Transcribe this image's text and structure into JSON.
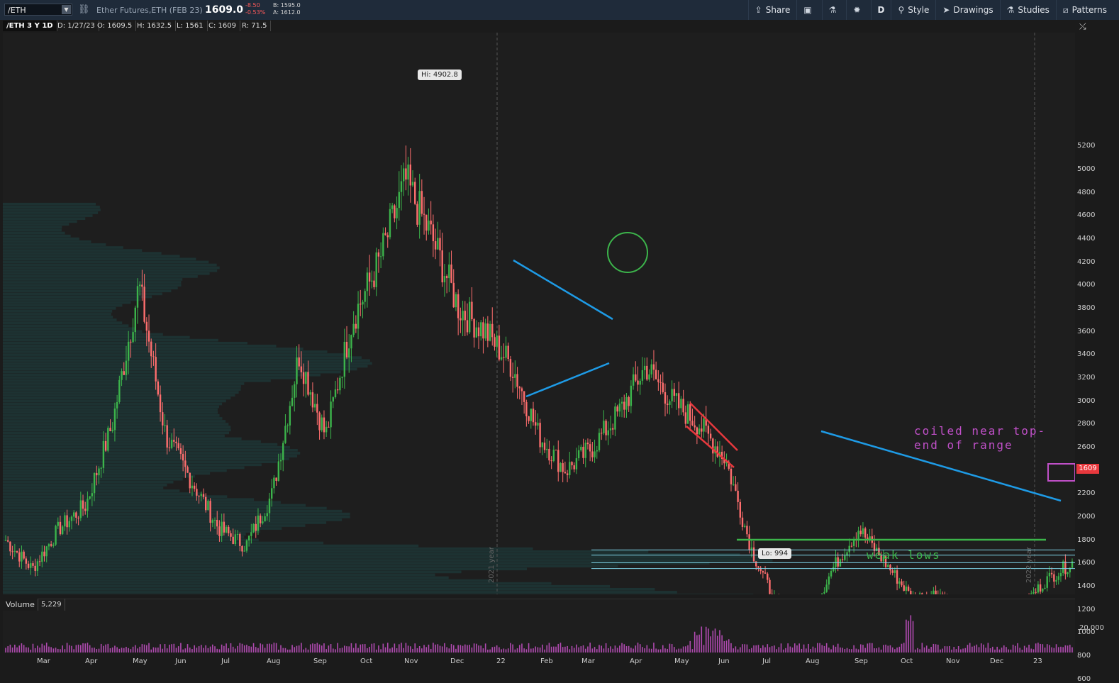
{
  "toolbar": {
    "symbol": "/ETH",
    "description": "Ether Futures,ETH (FEB 23)",
    "last_price": "1609.0",
    "net_change": "-8.50",
    "pct_change": "-0.53%",
    "bid": "B: 1595.0",
    "ask": "A: 1612.0",
    "share_label": "Share",
    "aggregation": "D",
    "style_label": "Style",
    "drawings_label": "Drawings",
    "studies_label": "Studies",
    "patterns_label": "Patterns"
  },
  "info": {
    "title": "/ETH 3 Y 1D",
    "date": "D: 1/27/23",
    "open": "O: 1609.5",
    "high": "H: 1632.5",
    "low": "L: 1561",
    "close": "C: 1609",
    "range": "R: 71.5"
  },
  "y_ticks": [
    "5200",
    "5000",
    "4800",
    "4600",
    "4400",
    "4200",
    "4000",
    "3800",
    "3600",
    "3400",
    "3200",
    "3000",
    "2800",
    "2600",
    "2400",
    "2200",
    "2000",
    "1800",
    "1600",
    "1400",
    "1200",
    "1000",
    "800",
    "600"
  ],
  "x_ticks": [
    "Mar",
    "Apr",
    "May",
    "Jun",
    "Jul",
    "Aug",
    "Sep",
    "Oct",
    "Nov",
    "Dec",
    "22",
    "Feb",
    "Mar",
    "Apr",
    "May",
    "Jun",
    "Jul",
    "Aug",
    "Sep",
    "Oct",
    "Nov",
    "Dec",
    "23"
  ],
  "year_labels": [
    "2021 year",
    "2022 year"
  ],
  "price_tag": "1609",
  "hi_label": "Hi: 4902.8",
  "lo_label": "Lo: 994",
  "annotations": {
    "coiled_line1": "coiled near top-",
    "coiled_line2": "end of range",
    "weak_lows": "weak lows"
  },
  "volume": {
    "label": "Volume",
    "value": "5,229",
    "tick": "20,000"
  },
  "colors": {
    "up_candle": "#3cb44b",
    "down_candle": "#ff6e6e",
    "trendline_blue": "#1e9be6",
    "channel_red": "#e8383d",
    "support_green": "#3cb44b",
    "annotation_magenta": "#c050c8",
    "annotation_green": "#3cb44b",
    "volume_profile": "#1d3a3a"
  },
  "chart_data": {
    "type": "candlestick",
    "ylim": [
      500,
      5300
    ],
    "x": [
      "2020-03",
      "2020-04",
      "2020-05",
      "2020-06",
      "2020-07",
      "2020-08",
      "2020-09",
      "2020-10",
      "2020-11",
      "2020-12",
      "2021-01",
      "2021-02",
      "2021-03",
      "2021-04",
      "2021-05",
      "2021-06",
      "2021-07",
      "2021-08",
      "2021-09",
      "2021-10",
      "2021-11",
      "2021-12",
      "2022-01"
    ],
    "close_path": [
      1800,
      1550,
      1900,
      2100,
      2800,
      4000,
      2700,
      2300,
      1900,
      1750,
      2200,
      3400,
      2700,
      3700,
      4200,
      4900,
      4400,
      3800,
      3600,
      3300,
      2700,
      2400,
      2600,
      2900,
      3300,
      3000,
      2800,
      2500,
      1700,
      1200,
      1050,
      1550,
      1900,
      1600,
      1300,
      1350,
      1080,
      1250,
      1200,
      1450,
      1609
    ],
    "hi": 4902.8,
    "lo": 994,
    "last": 1609
  }
}
